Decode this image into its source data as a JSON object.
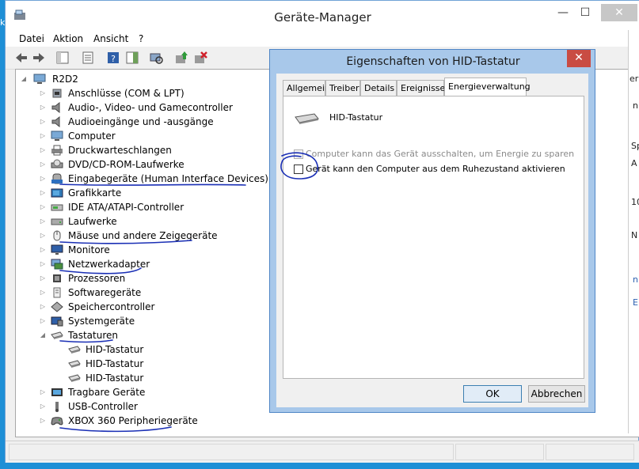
{
  "window": {
    "title": "Geräte-Manager",
    "minimize": "—",
    "maximize": "☐",
    "close": "✕"
  },
  "menu": [
    "Datei",
    "Aktion",
    "Ansicht",
    "?"
  ],
  "tree": {
    "root": "R2D2",
    "items": [
      {
        "label": "Anschlüsse (COM & LPT)",
        "icon": "port-icon"
      },
      {
        "label": "Audio-, Video- und Gamecontroller",
        "icon": "speaker-icon"
      },
      {
        "label": "Audioeingänge und -ausgänge",
        "icon": "speaker-icon"
      },
      {
        "label": "Computer",
        "icon": "computer-icon"
      },
      {
        "label": "Druckwarteschlangen",
        "icon": "printer-icon"
      },
      {
        "label": "DVD/CD-ROM-Laufwerke",
        "icon": "disc-drive-icon"
      },
      {
        "label": "Eingabegeräte (Human Interface Devices)",
        "icon": "hid-icon"
      },
      {
        "label": "Grafikkarte",
        "icon": "display-adapter-icon"
      },
      {
        "label": "IDE ATA/ATAPI-Controller",
        "icon": "ide-icon"
      },
      {
        "label": "Laufwerke",
        "icon": "drive-icon"
      },
      {
        "label": "Mäuse und andere Zeigegeräte",
        "icon": "mouse-icon"
      },
      {
        "label": "Monitore",
        "icon": "monitor-icon"
      },
      {
        "label": "Netzwerkadapter",
        "icon": "network-icon"
      },
      {
        "label": "Prozessoren",
        "icon": "cpu-icon"
      },
      {
        "label": "Softwaregeräte",
        "icon": "software-device-icon"
      },
      {
        "label": "Speichercontroller",
        "icon": "storage-controller-icon"
      },
      {
        "label": "Systemgeräte",
        "icon": "system-device-icon"
      },
      {
        "label": "Tastaturen",
        "icon": "keyboard-icon"
      },
      {
        "label": "HID-Tastatur",
        "icon": "keyboard-icon"
      },
      {
        "label": "HID-Tastatur",
        "icon": "keyboard-icon"
      },
      {
        "label": "HID-Tastatur",
        "icon": "keyboard-icon"
      },
      {
        "label": "Tragbare Geräte",
        "icon": "portable-device-icon"
      },
      {
        "label": "USB-Controller",
        "icon": "usb-icon"
      },
      {
        "label": "XBOX 360 Peripheriegeräte",
        "icon": "gamepad-icon"
      }
    ]
  },
  "dialog": {
    "title": "Eigenschaften von HID-Tastatur",
    "close": "✕",
    "tabs": [
      "Allgemein",
      "Treiber",
      "Details",
      "Ereignisse",
      "Energieverwaltung"
    ],
    "device_name": "HID-Tastatur",
    "option1": "Computer kann das Gerät ausschalten, um Energie zu sparen",
    "option2": "Gerät kann den Computer aus dem Ruhezustand aktivieren",
    "ok": "OK",
    "cancel": "Abbrechen"
  },
  "desktop_edge": {
    "left": [
      "k"
    ],
    "right": [
      "er",
      "n",
      "Sp",
      "A",
      "10",
      "N",
      "n",
      "E"
    ]
  },
  "colors": {
    "accent_blue": "#1e8fd6",
    "annotation_ink": "#1a2fb5",
    "dialog_frame": "#a8c8ea",
    "close_red": "#c94c43"
  }
}
